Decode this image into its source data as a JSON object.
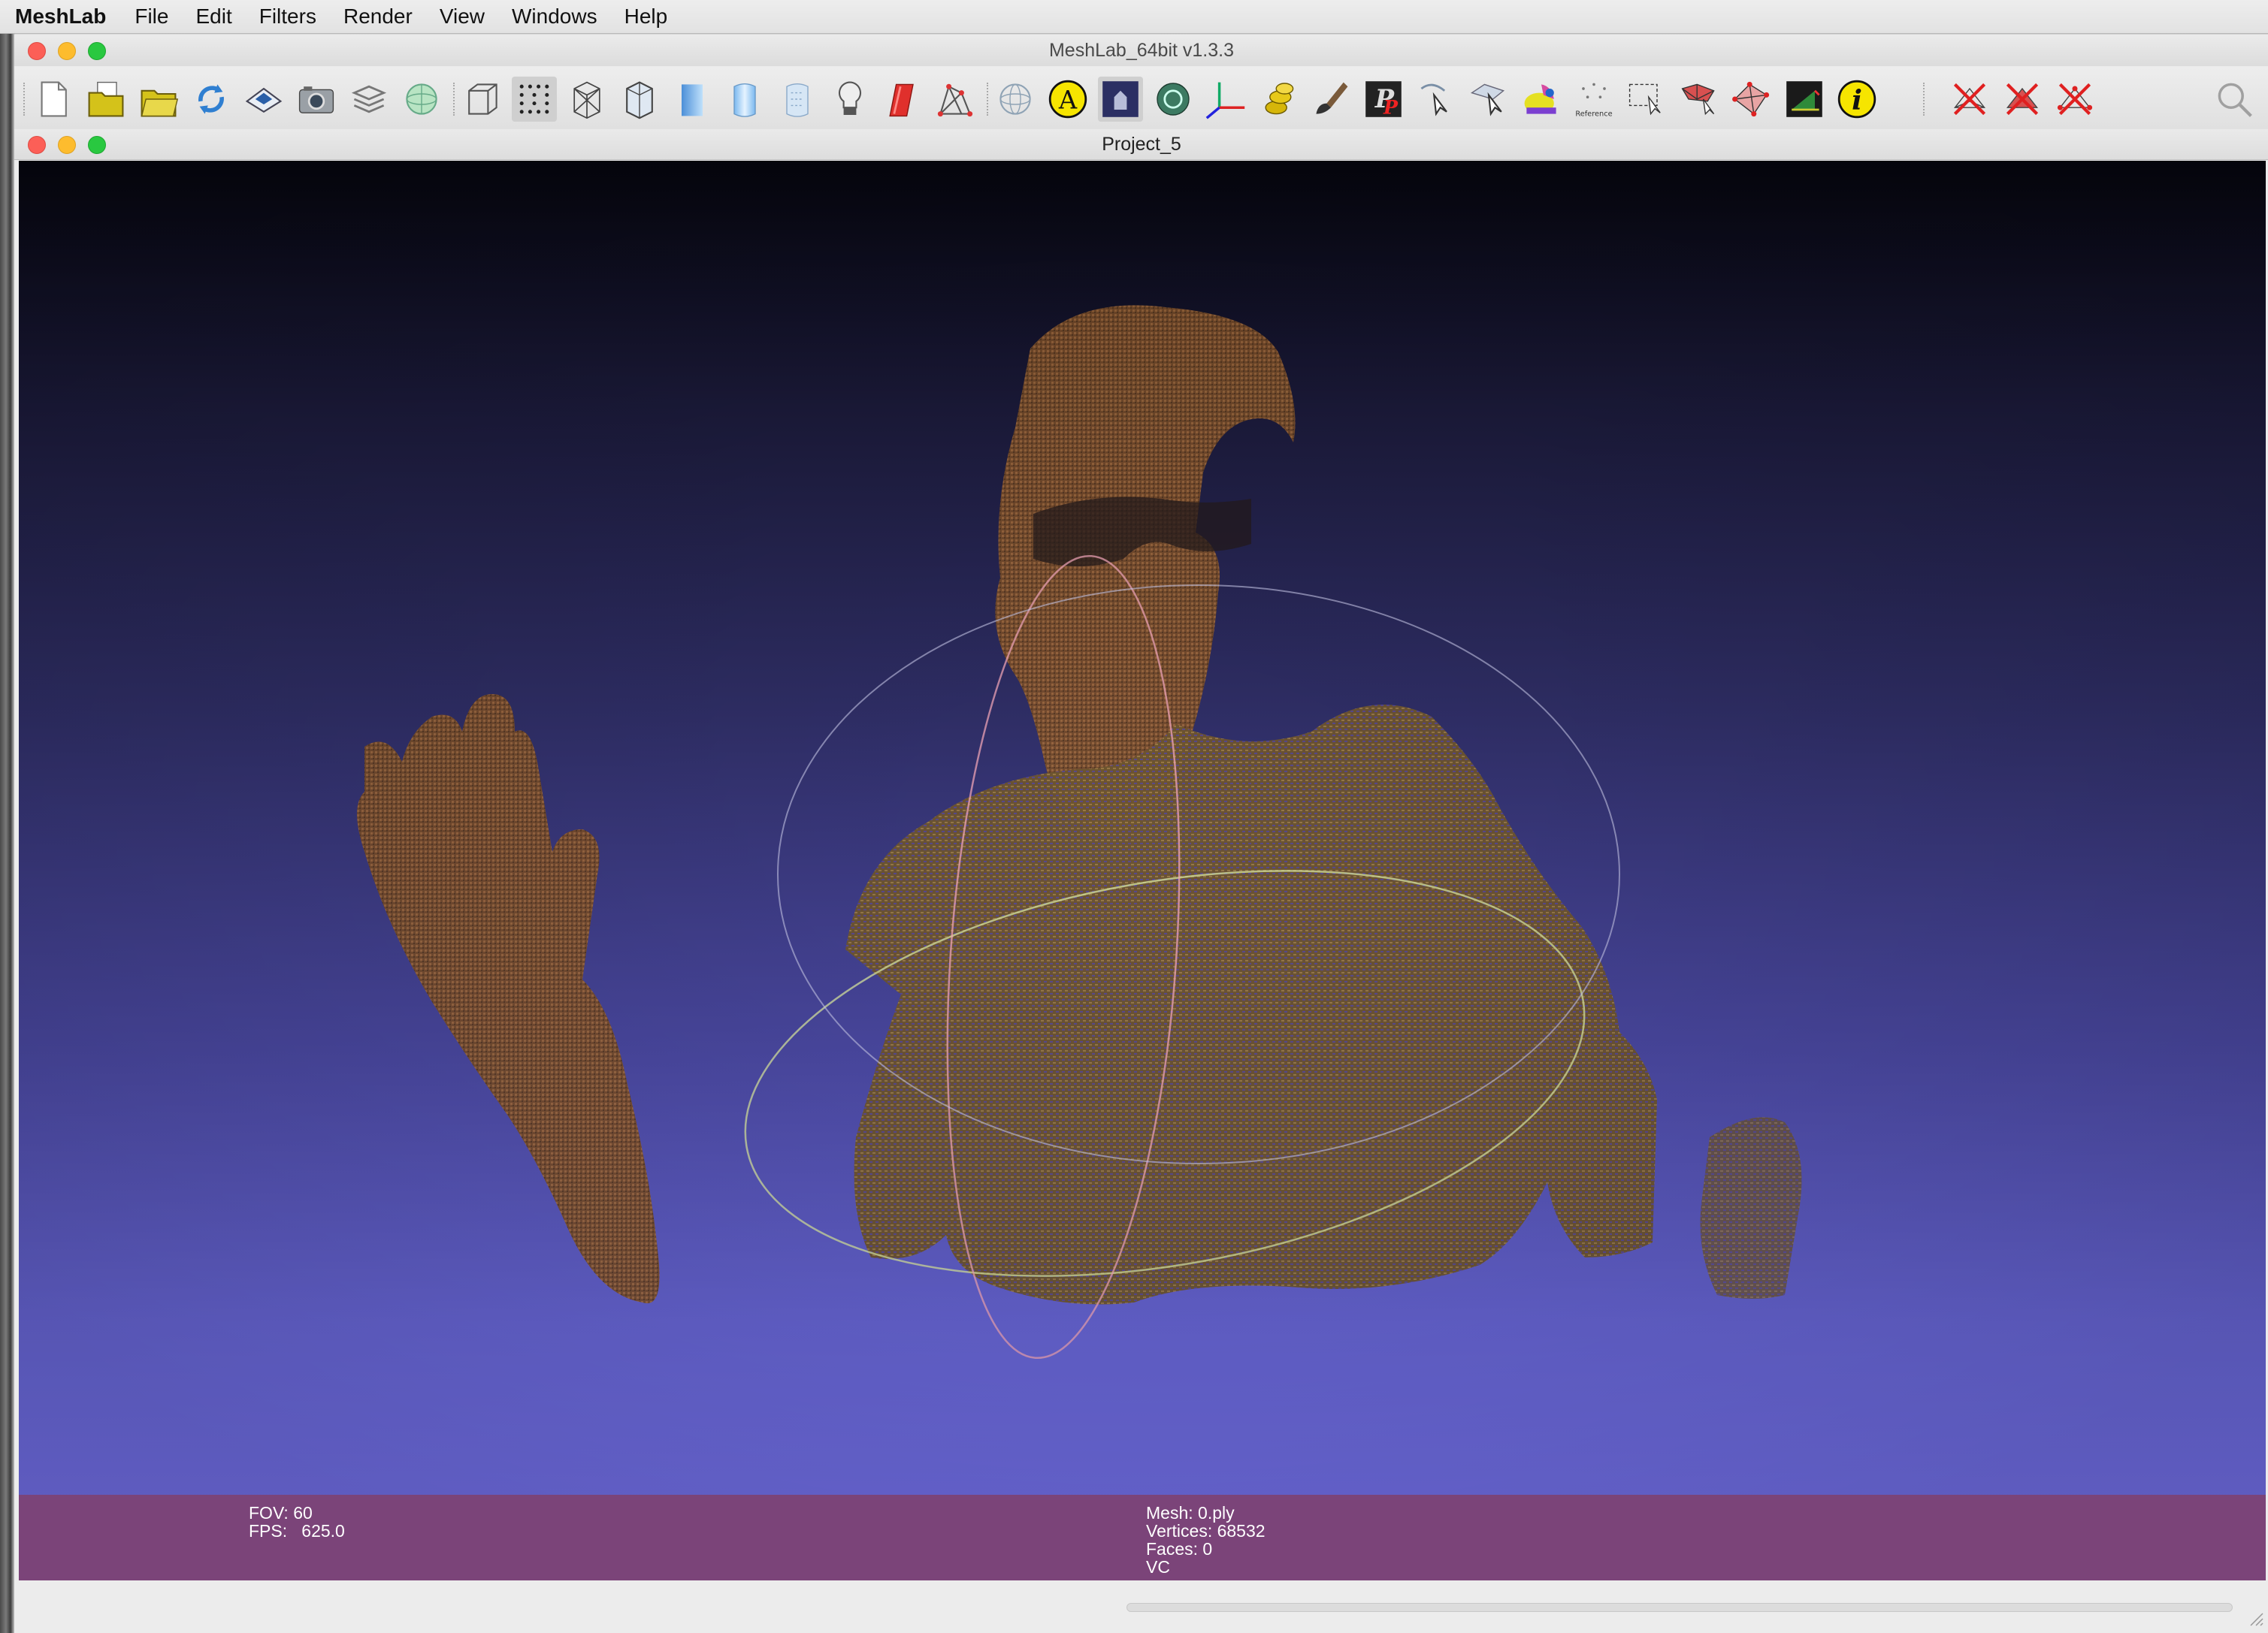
{
  "menubar": {
    "app_name": "MeshLab",
    "items": [
      "File",
      "Edit",
      "Filters",
      "Render",
      "View",
      "Windows",
      "Help"
    ]
  },
  "window": {
    "title": "MeshLab_64bit v1.3.3",
    "project_title": "Project_5"
  },
  "toolbar": {
    "icons": [
      "new-project-icon",
      "open-project-icon",
      "open-mesh-icon",
      "reload-icon",
      "save-icon",
      "snapshot-icon",
      "layers-icon",
      "globe-icon",
      "bbox-icon",
      "points-icon",
      "wireframe-icon",
      "hidden-lines-icon",
      "flat-icon",
      "smooth-icon",
      "texture-icon",
      "light-icon",
      "color-icon",
      "polylines-icon",
      "trackball-icon",
      "annotation-icon",
      "paint-dark-icon",
      "measure-icon",
      "axis-icon",
      "coins-icon",
      "brush-icon",
      "point-picker-icon",
      "select-tool-icon",
      "select-tool-2-icon",
      "z-paint-icon",
      "reference-icon",
      "select-rect-icon",
      "select-faces-icon",
      "select-vertices-icon",
      "align-icon",
      "info-icon",
      "delete-icon",
      "delete-faces-icon",
      "delete-vertices-icon",
      "search-icon"
    ],
    "reference_label": "Reference"
  },
  "viewport_info": {
    "fov_label": "FOV: 60",
    "fps_label": "FPS:   625.0",
    "mesh_label": "Mesh: 0.ply",
    "vertices_label": "Vertices: 68532",
    "faces_label": "Faces: 0",
    "mode_label": "VC"
  },
  "colors": {
    "viewport_top": "#05050d",
    "viewport_bottom": "#706de4",
    "info_bar": "#7b4479",
    "point_cloud": "#8a5a2e"
  }
}
